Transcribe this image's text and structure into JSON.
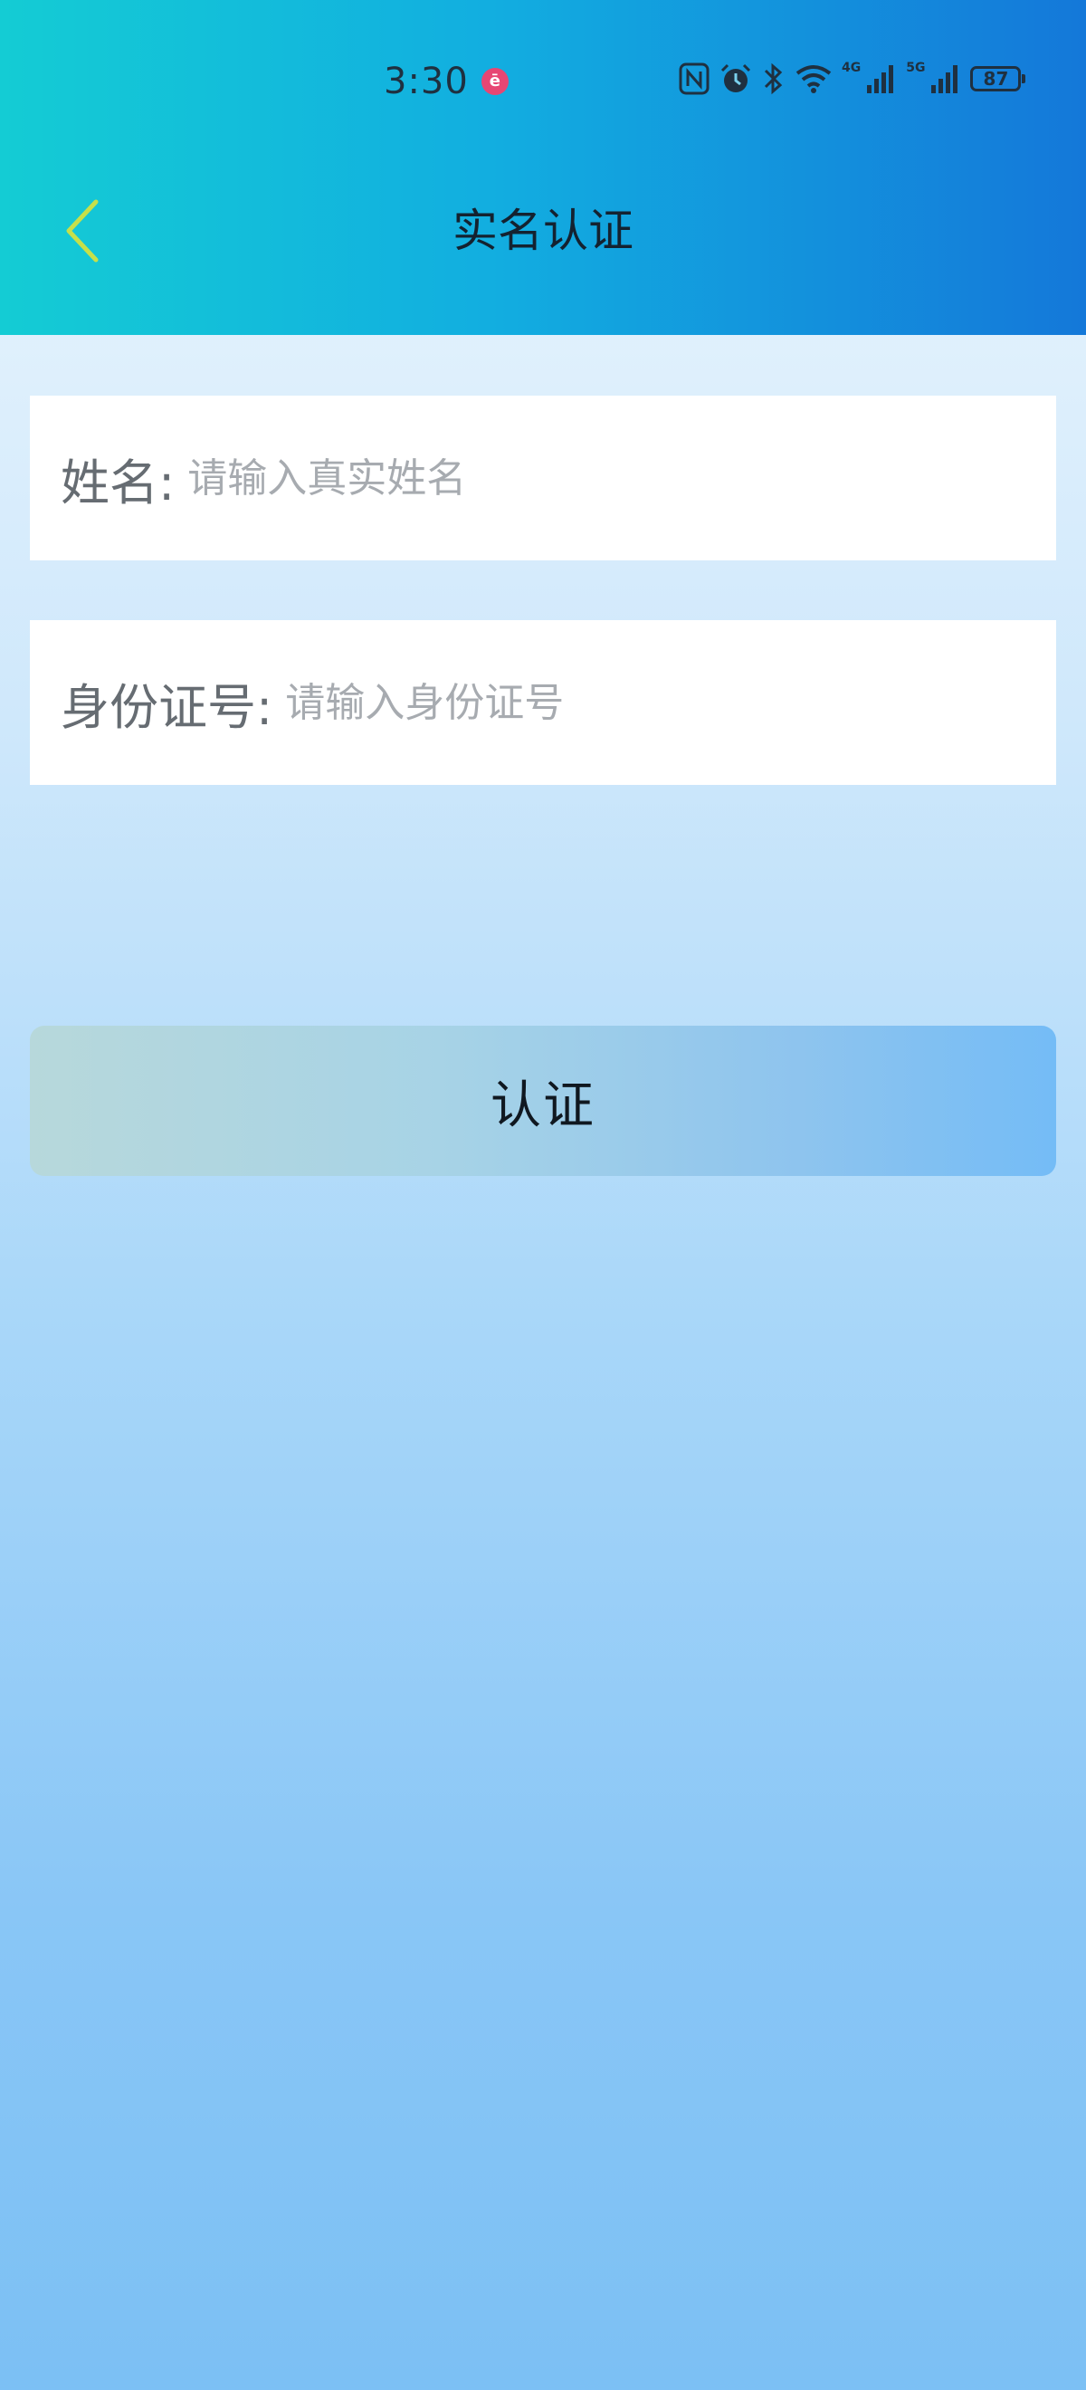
{
  "status_bar": {
    "time": "3:30",
    "notification_badge": "Ɛ",
    "net_4g": "4G",
    "net_5g": "5G",
    "battery": "87"
  },
  "nav": {
    "title": "实名认证",
    "back_icon": "chevron-left-icon",
    "back_color": "#c6e04a"
  },
  "form": {
    "name": {
      "label": "姓名:",
      "placeholder": "请输入真实姓名",
      "value": ""
    },
    "id_number": {
      "label": "身份证号:",
      "placeholder": "请输入身份证号",
      "value": ""
    }
  },
  "submit": {
    "label": "认证"
  },
  "colors": {
    "header_start": "#14ccd4",
    "header_end": "#1478d9",
    "button_start": "#b7d8db",
    "button_end": "#74bcf6"
  }
}
